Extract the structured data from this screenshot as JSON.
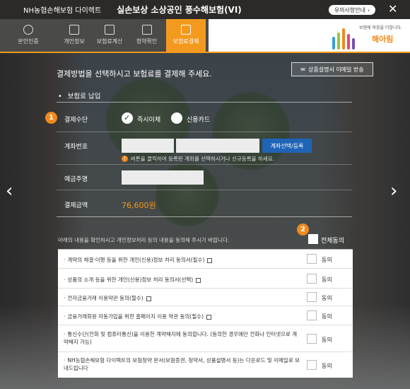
{
  "titlebar": {
    "brand": "NH농협손해보험 다이렉트",
    "product": "실손보상 소상공인 풍수해보험(VI)",
    "notice_label": "유의사항안내",
    "notice_arrow": "›",
    "close_glyph": "✕"
  },
  "nav": {
    "tabs": [
      {
        "label": "본인인증",
        "icon": "user-circle-icon"
      },
      {
        "label": "개인정보",
        "icon": "edit-icon"
      },
      {
        "label": "보험료계산",
        "icon": "calculator-icon"
      },
      {
        "label": "청약확인",
        "icon": "checkbox-icon"
      },
      {
        "label": "보험료결제",
        "icon": "card-payment-icon"
      }
    ],
    "active_tab": 4
  },
  "logo": {
    "slogan": "보험에 마음을 더합니다.",
    "name": "해아림",
    "bar_colors": [
      "#3a9fd9",
      "#9bc43a",
      "#f08a1e",
      "#e8457a",
      "#7a4fb5",
      "#3ab7a6"
    ]
  },
  "payment": {
    "headline": "결제방법을 선택하시고 보험료를 결제해 주세요.",
    "email_button": "상품설명서 이메일 받송",
    "section_title": "보험료 납입",
    "step1_badge": "1",
    "method_label": "결제수단",
    "method_options": [
      {
        "label": "즉시이체",
        "selected": true
      },
      {
        "label": "신용카드",
        "selected": false
      }
    ],
    "account_label": "계좌번호",
    "account_value_1": "",
    "account_value_2": "",
    "account_select_button": "계좌선택/등록",
    "account_hint": "버튼을 클릭하여 등록된 계좌를 선택하시거나 신규등록을 하세요.",
    "account_hint_icon": "!",
    "holder_label": "예금주명",
    "holder_value": "",
    "amount_label": "결제금액",
    "amount_value": "76,600원"
  },
  "consent": {
    "step2_badge": "2",
    "intro": "아래의 내용을 확인하시고 개인정보처리 등의 내용을 동의해 주시기 바랍니다.",
    "all_label": "전체동의",
    "agree_label": "동의",
    "items": [
      {
        "text": "계약의 체결·이행 등을 위한 개인(신용)정보 처리 동의서(필수)"
      },
      {
        "text": "상품의 소개 등을 위한 개인(신용)정보 처리 동의서(선택)"
      },
      {
        "text": "전자금융거래 이용약관 동의(필수)"
      },
      {
        "text": "금융거래회원 자동가입을 위한 홈페이지 이용 약관 동의(필수)"
      },
      {
        "text": "통신수단(전화 및 컴퓨터통신)을 이용한 계약해지에 동의합니다. (동의한 경우에만 전화나 인터넷으로 계약해지 가능)"
      },
      {
        "text": "NH농협손해보험 다이렉트의 보험청약 문서(보험증권, 청약서, 상품설명서 등)는 다운로드 및 이메일로 보내드립니다"
      }
    ]
  },
  "carousel": {
    "prev_glyph": "‹",
    "next_glyph": "›"
  }
}
